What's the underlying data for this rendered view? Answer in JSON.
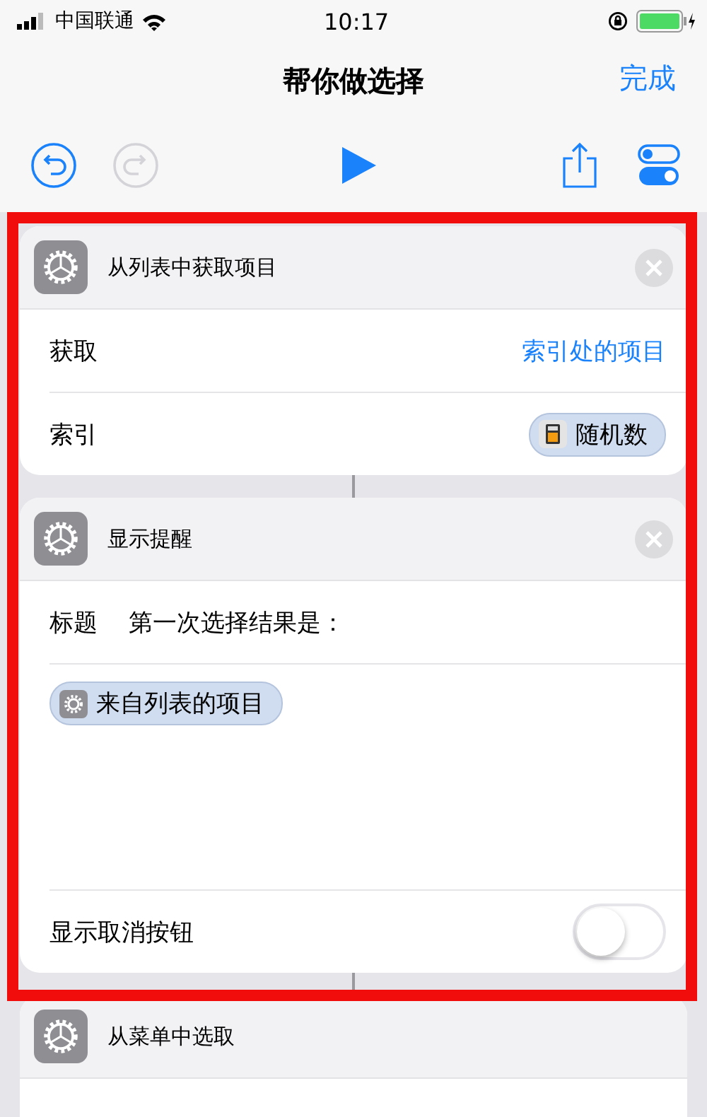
{
  "status_bar": {
    "carrier": "中国联通",
    "time": "10:17"
  },
  "nav": {
    "title": "帮你做选择",
    "done": "完成"
  },
  "toolbar": [
    {
      "kind": "undo",
      "disabled": false
    },
    {
      "kind": "redo",
      "disabled": true
    },
    {
      "kind": "play",
      "disabled": false
    },
    {
      "kind": "share",
      "disabled": false
    },
    {
      "kind": "settings",
      "disabled": false
    }
  ],
  "actions": [
    {
      "title": "从列表中获取项目",
      "closable": true,
      "rows": [
        {
          "kind": "choice",
          "label": "获取",
          "value": "索引处的项目"
        },
        {
          "kind": "variable",
          "label": "索引",
          "token": {
            "kind": "calculator",
            "label": "随机数"
          }
        }
      ]
    },
    {
      "title": "显示提醒",
      "closable": true,
      "rows": [
        {
          "kind": "text",
          "label": "标题",
          "value": "第一次选择结果是："
        },
        {
          "kind": "token_area",
          "token": {
            "kind": "gear",
            "label": "来自列表的项目"
          }
        },
        {
          "kind": "toggle",
          "label": "显示取消按钮",
          "on": false
        }
      ]
    },
    {
      "title": "从菜单中选取",
      "closable": false
    }
  ]
}
